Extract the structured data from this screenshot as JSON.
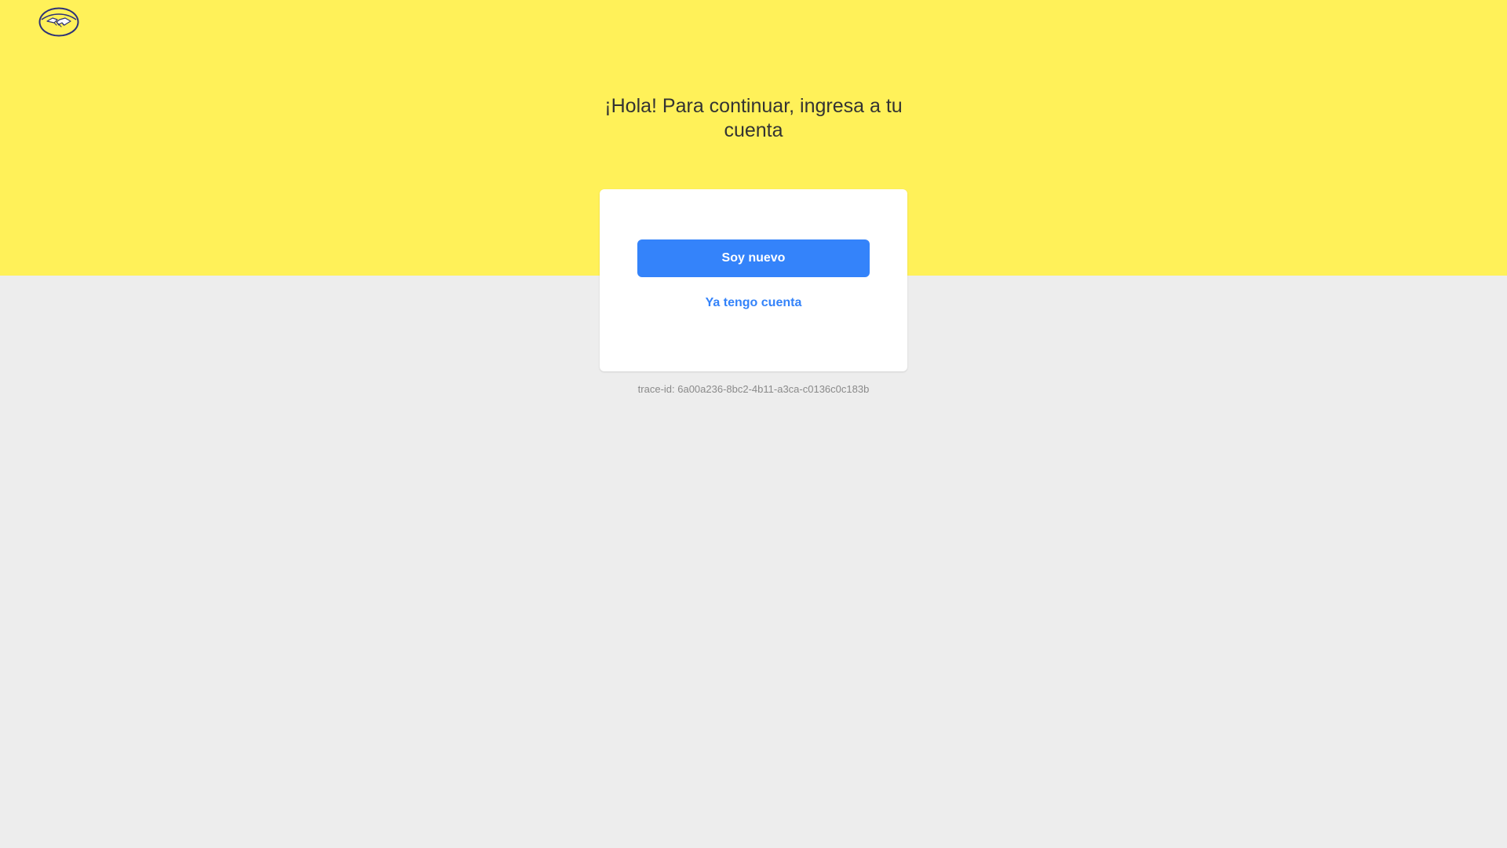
{
  "header": {
    "logo_icon": "handshake-logo-icon"
  },
  "main": {
    "headline": "¡Hola! Para continuar, ingresa a tu cuenta",
    "primary_button_label": "Soy nuevo",
    "secondary_link_label": "Ya tengo cuenta",
    "trace_id": "trace-id: 6a00a236-8bc2-4b11-a3ca-c0136c0c183b"
  },
  "colors": {
    "brand_yellow": "#fff159",
    "background_gray": "#ededed",
    "accent_blue": "#3483fa",
    "text_dark": "#333333",
    "text_muted": "#8a8a8a"
  }
}
